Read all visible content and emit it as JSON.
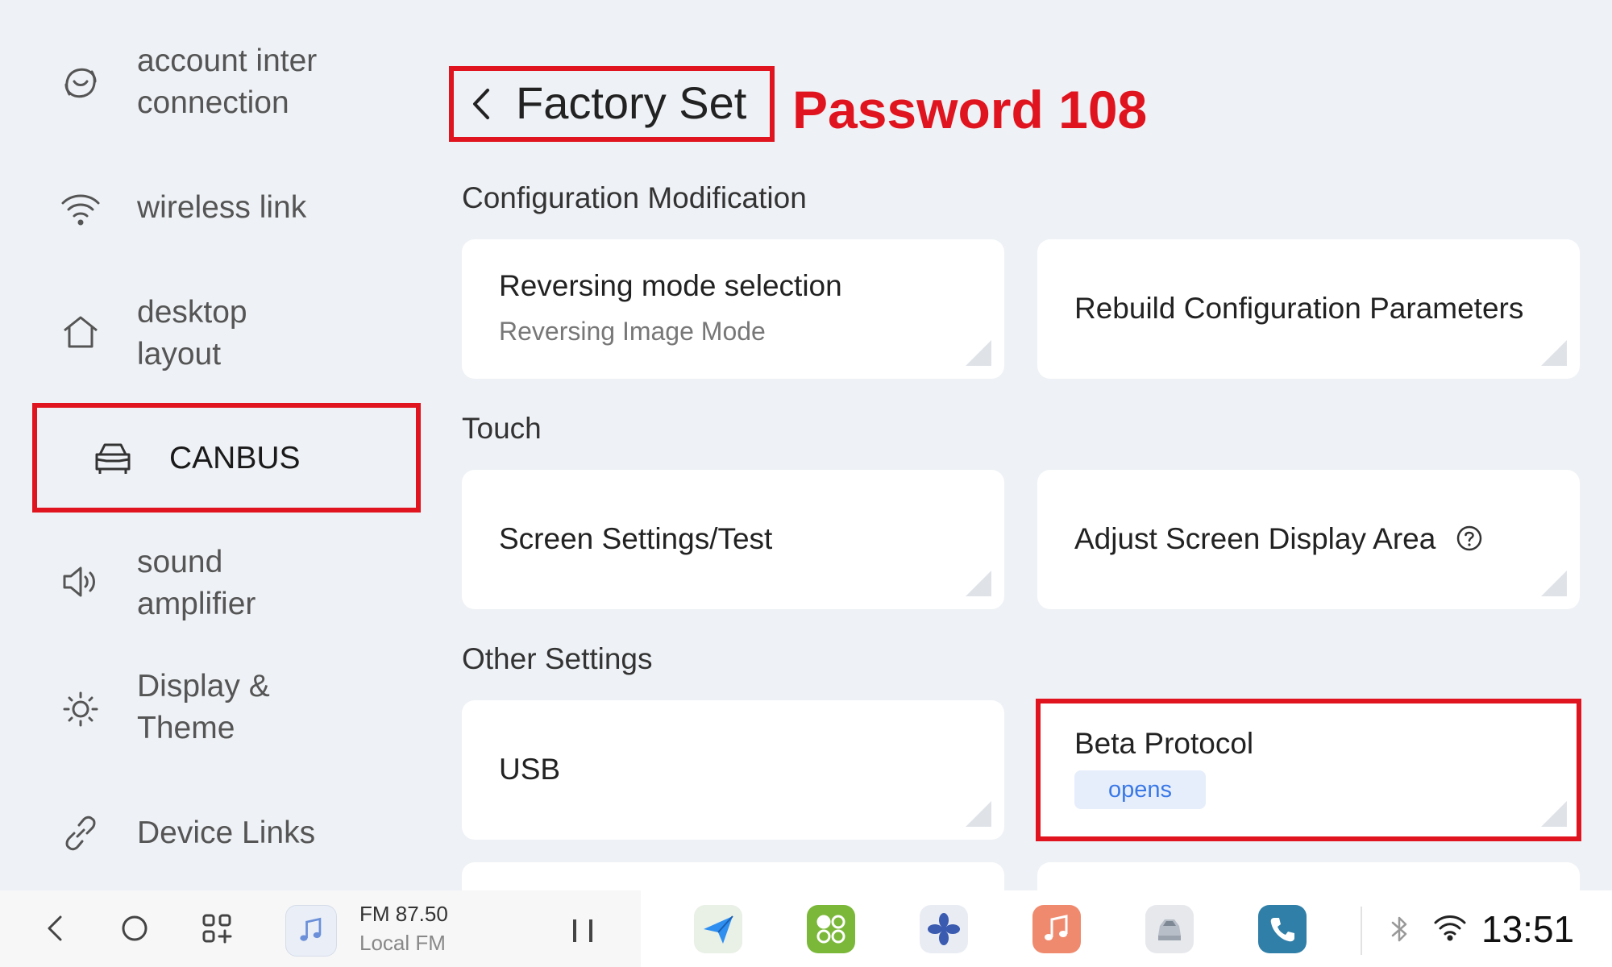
{
  "sidebar": {
    "items": [
      {
        "label_line1": "account inter",
        "label_line2": "connection",
        "icon": "account-link-icon"
      },
      {
        "label": "wireless link",
        "icon": "wifi-icon"
      },
      {
        "label_line1": "desktop",
        "label_line2": "layout",
        "icon": "home-icon"
      },
      {
        "label": "CANBUS",
        "icon": "car-icon",
        "active": true
      },
      {
        "label_line1": "sound",
        "label_line2": "amplifier",
        "icon": "speaker-icon"
      },
      {
        "label_line1": "Display &",
        "label_line2": "Theme",
        "icon": "brightness-icon"
      },
      {
        "label": "Device Links",
        "icon": "link-icon"
      }
    ]
  },
  "header": {
    "title": "Factory Set",
    "annotation": "Password 108"
  },
  "sections": [
    {
      "title": "Configuration Modification",
      "cards": [
        {
          "title": "Reversing mode selection",
          "subtitle": "Reversing Image Mode"
        },
        {
          "title": "Rebuild Configuration Parameters"
        }
      ]
    },
    {
      "title": "Touch",
      "cards": [
        {
          "title": "Screen Settings/Test"
        },
        {
          "title": "Adjust Screen Display Area"
        }
      ]
    },
    {
      "title": "Other Settings",
      "cards": [
        {
          "title": "USB"
        },
        {
          "title": "Beta Protocol",
          "badge": "opens"
        }
      ]
    }
  ],
  "taskbar": {
    "media": {
      "frequency": "FM 87.50",
      "station": "Local FM"
    },
    "apps": [
      "navigation-app-icon",
      "apps-grid-app-icon",
      "fan-app-icon",
      "music-app-icon",
      "car-app-icon",
      "phone-app-icon"
    ],
    "clock": "13:51"
  },
  "colors": {
    "highlight": "#e0141e",
    "background": "#eef1f5",
    "card": "#ffffff",
    "badge_text": "#3a78e6",
    "badge_bg": "#e6eefc"
  }
}
